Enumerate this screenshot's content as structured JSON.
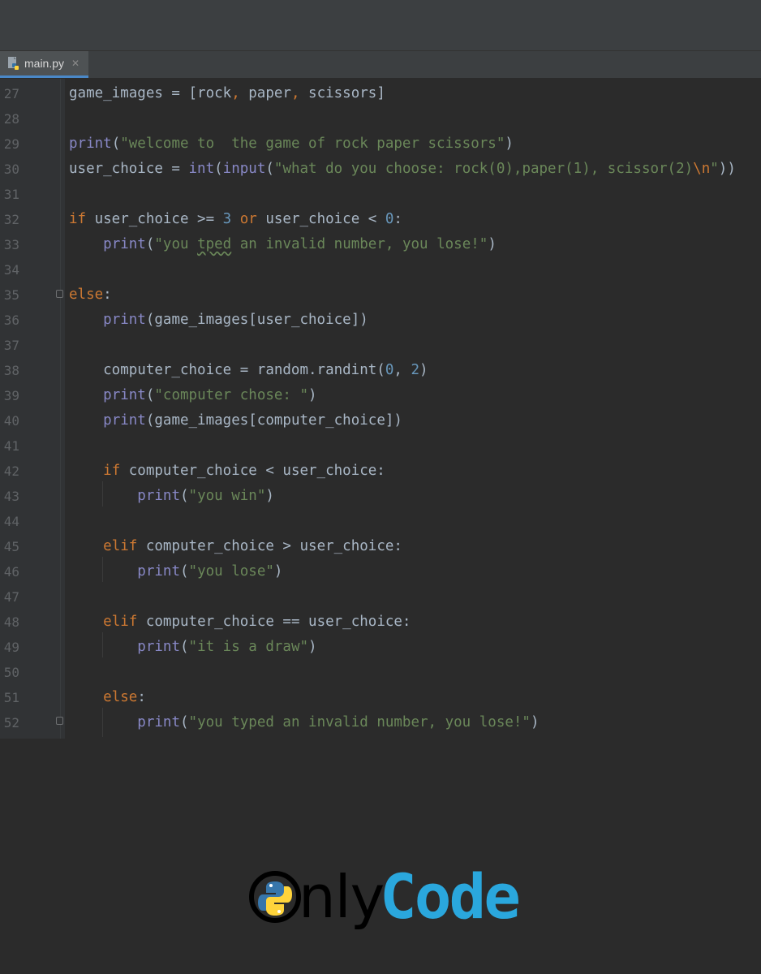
{
  "tab": {
    "filename": "main.py",
    "close_glyph": "✕",
    "icon": "python-file-icon"
  },
  "colors": {
    "keyword": "#cc7832",
    "builtin": "#8888c6",
    "string": "#6a8759",
    "number": "#6897bb",
    "text": "#a9b7c6",
    "brand": "#2aa7dd"
  },
  "lines": [
    {
      "no": "27",
      "tokens": [
        [
          "game_images = [rock",
          ""
        ],
        [
          ",",
          "kw"
        ],
        [
          " paper",
          ""
        ],
        [
          ",",
          "kw"
        ],
        [
          " scissors]",
          ""
        ]
      ]
    },
    {
      "no": "28",
      "tokens": []
    },
    {
      "no": "29",
      "tokens": [
        [
          "print",
          "fn"
        ],
        [
          "(",
          ""
        ],
        [
          "\"welcome to  the game of rock paper scissors\"",
          "str"
        ],
        [
          ")",
          ""
        ]
      ]
    },
    {
      "no": "30",
      "tokens": [
        [
          "user_choice = ",
          ""
        ],
        [
          "int",
          "fn"
        ],
        [
          "(",
          ""
        ],
        [
          "input",
          "fn"
        ],
        [
          "(",
          ""
        ],
        [
          "\"what do you choose: rock(0),paper(1), scissor(2)",
          "str"
        ],
        [
          "\\n",
          "esc"
        ],
        [
          "\"",
          "str"
        ],
        [
          "))",
          ""
        ]
      ]
    },
    {
      "no": "31",
      "tokens": []
    },
    {
      "no": "32",
      "tokens": [
        [
          "if",
          "kw"
        ],
        [
          " user_choice >= ",
          ""
        ],
        [
          "3",
          "num"
        ],
        [
          " ",
          ""
        ],
        [
          "or",
          "kw"
        ],
        [
          " user_choice < ",
          ""
        ],
        [
          "0",
          "num"
        ],
        [
          ":",
          ""
        ]
      ]
    },
    {
      "no": "33",
      "tokens": [
        [
          "    ",
          ""
        ],
        [
          "print",
          "fn"
        ],
        [
          "(",
          ""
        ],
        [
          "\"you ",
          "str"
        ],
        [
          "tped",
          "str typo"
        ],
        [
          " an invalid number, you lose!\"",
          "str"
        ],
        [
          ")",
          ""
        ]
      ]
    },
    {
      "no": "34",
      "tokens": []
    },
    {
      "no": "35",
      "tokens": [
        [
          "else",
          "kw"
        ],
        [
          ":",
          ""
        ]
      ]
    },
    {
      "no": "36",
      "tokens": [
        [
          "    ",
          ""
        ],
        [
          "print",
          "fn"
        ],
        [
          "(game_images[user_choice])",
          ""
        ]
      ]
    },
    {
      "no": "37",
      "tokens": []
    },
    {
      "no": "38",
      "tokens": [
        [
          "    computer_choice = random.randint(",
          ""
        ],
        [
          "0",
          "num"
        ],
        [
          ", ",
          ""
        ],
        [
          "2",
          "num"
        ],
        [
          ")",
          ""
        ]
      ]
    },
    {
      "no": "39",
      "tokens": [
        [
          "    ",
          ""
        ],
        [
          "print",
          "fn"
        ],
        [
          "(",
          ""
        ],
        [
          "\"computer chose: \"",
          "str"
        ],
        [
          ")",
          ""
        ]
      ]
    },
    {
      "no": "40",
      "tokens": [
        [
          "    ",
          ""
        ],
        [
          "print",
          "fn"
        ],
        [
          "(game_images[computer_choice])",
          ""
        ]
      ]
    },
    {
      "no": "41",
      "tokens": []
    },
    {
      "no": "42",
      "tokens": [
        [
          "    ",
          ""
        ],
        [
          "if",
          "kw"
        ],
        [
          " computer_choice < user_choice:",
          ""
        ]
      ]
    },
    {
      "no": "43",
      "tokens": [
        [
          "        ",
          ""
        ],
        [
          "print",
          "fn"
        ],
        [
          "(",
          ""
        ],
        [
          "\"you win\"",
          "str"
        ],
        [
          ")",
          ""
        ]
      ]
    },
    {
      "no": "44",
      "tokens": []
    },
    {
      "no": "45",
      "tokens": [
        [
          "    ",
          ""
        ],
        [
          "elif",
          "kw"
        ],
        [
          " computer_choice > user_choice:",
          ""
        ]
      ]
    },
    {
      "no": "46",
      "tokens": [
        [
          "        ",
          ""
        ],
        [
          "print",
          "fn"
        ],
        [
          "(",
          ""
        ],
        [
          "\"you lose\"",
          "str"
        ],
        [
          ")",
          ""
        ]
      ]
    },
    {
      "no": "47",
      "tokens": []
    },
    {
      "no": "48",
      "tokens": [
        [
          "    ",
          ""
        ],
        [
          "elif",
          "kw"
        ],
        [
          " computer_choice == user_choice:",
          ""
        ]
      ]
    },
    {
      "no": "49",
      "tokens": [
        [
          "        ",
          ""
        ],
        [
          "print",
          "fn"
        ],
        [
          "(",
          ""
        ],
        [
          "\"it is a draw\"",
          "str"
        ],
        [
          ")",
          ""
        ]
      ]
    },
    {
      "no": "50",
      "tokens": []
    },
    {
      "no": "51",
      "tokens": [
        [
          "    ",
          ""
        ],
        [
          "else",
          "kw"
        ],
        [
          ":",
          ""
        ]
      ]
    },
    {
      "no": "52",
      "tokens": [
        [
          "        ",
          ""
        ],
        [
          "print",
          "fn"
        ],
        [
          "(",
          ""
        ],
        [
          "\"you typed an invalid number, you lose!\"",
          "str"
        ],
        [
          ")",
          ""
        ]
      ]
    }
  ],
  "logo": {
    "text_dark": "nly",
    "text_brand": "Code",
    "icon": "python-logo-icon"
  }
}
